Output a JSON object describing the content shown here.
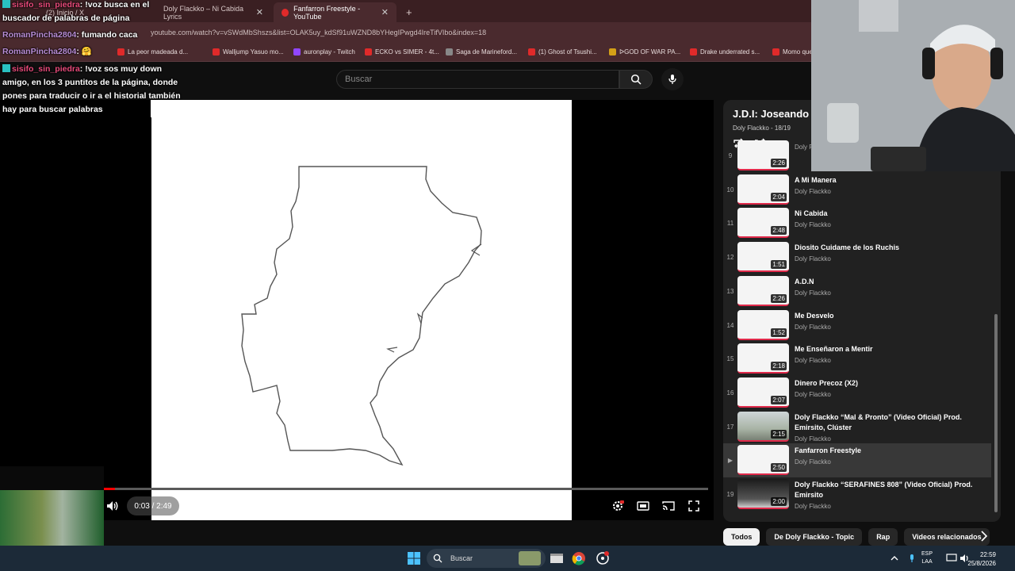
{
  "browser": {
    "tabs": [
      {
        "label": "(2) Inicio / X"
      },
      {
        "label": "Doly Flackko – Ni Cabida Lyrics"
      },
      {
        "label": "Fanfarron Freestyle - YouTube"
      }
    ],
    "new_tab": "+",
    "url": "youtube.com/watch?v=vSWdMbShszs&list=OLAK5uy_kdSf91uWZND8bYHegIPwgd4IreTifVIbo&index=18",
    "bookmarks": [
      "La peor madeada d...",
      "Walljump Yasuo mo...",
      "auronplay - Twitch",
      "ECKO vs SIMER - 4t...",
      "Saga de Marineford...",
      "(1) Ghost of Tsushi...",
      "ᐅGOD OF WAR PA...",
      "Drake underrated s...",
      "Momo que"
    ]
  },
  "youtube": {
    "search_placeholder": "Buscar",
    "player": {
      "time_current": "0:03",
      "time_total": "2:49",
      "time_display": "0:03 / 2:49",
      "progress": 0.018
    },
    "playlist": {
      "title": "J.D.I: Joseando a",
      "subtitle": "Doly Flackko - 18/19",
      "items": [
        {
          "index": "9",
          "title": "",
          "channel": "Doly Flackko",
          "duration": "2:26",
          "thumb": "white"
        },
        {
          "index": "10",
          "title": "A Mi Manera",
          "channel": "Doly Flackko",
          "duration": "2:04",
          "thumb": "white"
        },
        {
          "index": "11",
          "title": "Ni Cabida",
          "channel": "Doly Flackko",
          "duration": "2:48",
          "thumb": "white"
        },
        {
          "index": "12",
          "title": "Diosito Cuidame de los Ruchis",
          "channel": "Doly Flackko",
          "duration": "1:51",
          "thumb": "white"
        },
        {
          "index": "13",
          "title": "A.D.N",
          "channel": "Doly Flackko",
          "duration": "2:26",
          "thumb": "white"
        },
        {
          "index": "14",
          "title": "Me Desvelo",
          "channel": "Doly Flackko",
          "duration": "1:52",
          "thumb": "white"
        },
        {
          "index": "15",
          "title": "Me Enseñaron a Mentir",
          "channel": "Doly Flackko",
          "duration": "2:18",
          "thumb": "white"
        },
        {
          "index": "16",
          "title": "Dinero Precoz (X2)",
          "channel": "Doly Flackko",
          "duration": "2:07",
          "thumb": "white"
        },
        {
          "index": "17",
          "title": "Doly Flackko “Mal & Pronto” (Video Oficial) Prod. Emirsito, Clúster",
          "channel": "Doly Flackko",
          "duration": "2:15",
          "thumb": "photo"
        },
        {
          "index": "▶",
          "title": "Fanfarron Freestyle",
          "channel": "Doly Flackko",
          "duration": "2:50",
          "thumb": "white",
          "current": true
        },
        {
          "index": "19",
          "title": "Doly Flackko “SERAFINES 808” (Video Oficial) Prod. Emirsito",
          "channel": "Doly Flackko",
          "duration": "2:00",
          "thumb": "dark"
        }
      ]
    },
    "chips": [
      "Todos",
      "De Doly Flackko - Topic",
      "Rap",
      "Videos relacionados"
    ]
  },
  "chat": [
    {
      "user": "sisifo_sin_piedra",
      "text": ": !voz busca en el buscador de palabras de página",
      "color": "#e84a7a",
      "badge": true
    },
    {
      "user": "RomanPincha2804",
      "text": ": fumando caca",
      "color": "#b98dd6",
      "badge": false
    },
    {
      "user": "RomanPincha2804",
      "text": ": 🤗",
      "color": "#b98dd6",
      "badge": false
    },
    {
      "user": "sisifo_sin_piedra",
      "text": ": !voz sos muy down amigo, en los 3 puntitos de la página, donde pones para traducir o ir a el historial también hay para buscar palabras",
      "color": "#e84a7a",
      "badge": true
    }
  ],
  "taskbar": {
    "search_label": "Buscar",
    "lang_top": "ESP",
    "lang_bottom": "LAA",
    "time": "22:59",
    "date": "25/8/2026"
  },
  "colors": {
    "progress": "#ff0000",
    "yt_bg": "#0f0f0f",
    "chrome_tab": "#3a1f22"
  }
}
